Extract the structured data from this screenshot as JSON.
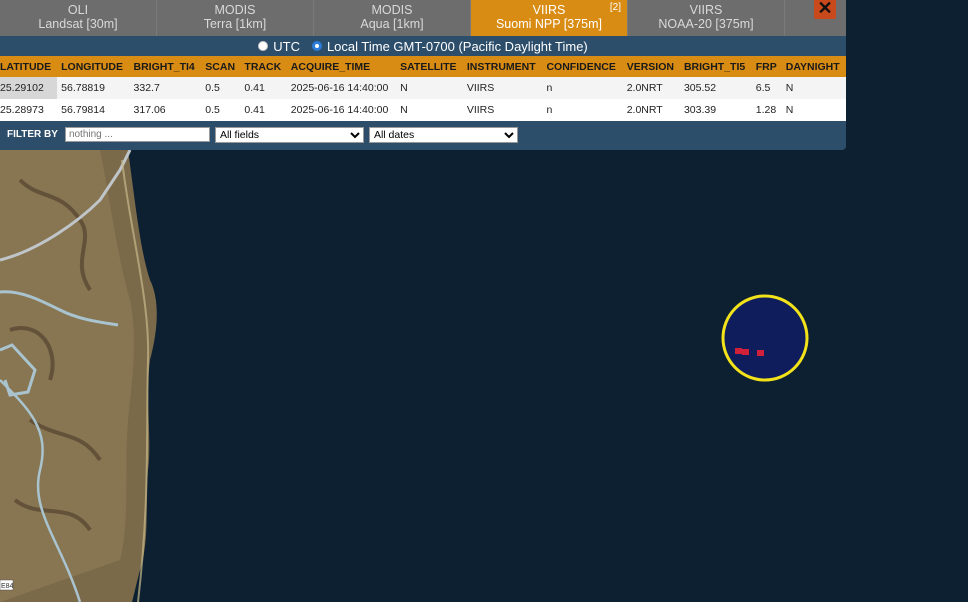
{
  "tabs": [
    {
      "line1": "OLI",
      "line2": "Landsat [30m]",
      "active": false,
      "count": ""
    },
    {
      "line1": "MODIS",
      "line2": "Terra [1km]",
      "active": false,
      "count": ""
    },
    {
      "line1": "MODIS",
      "line2": "Aqua [1km]",
      "active": false,
      "count": ""
    },
    {
      "line1": "VIIRS",
      "line2": "Suomi NPP [375m]",
      "active": true,
      "count": "[2]"
    },
    {
      "line1": "VIIRS",
      "line2": "NOAA-20 [375m]",
      "active": false,
      "count": ""
    }
  ],
  "close_label": "✕",
  "time_options": {
    "utc": "UTC",
    "local": "Local Time GMT-0700 (Pacific Daylight Time)",
    "selected": "local"
  },
  "table": {
    "columns": [
      "LATITUDE",
      "LONGITUDE",
      "BRIGHT_TI4",
      "SCAN",
      "TRACK",
      "ACQUIRE_TIME",
      "SATELLITE",
      "INSTRUMENT",
      "CONFIDENCE",
      "VERSION",
      "BRIGHT_TI5",
      "FRP",
      "DAYNIGHT"
    ],
    "rows": [
      [
        "25.29102",
        "56.78819",
        "332.7",
        "0.5",
        "0.41",
        "2025-06-16 14:40:00",
        "N",
        "VIIRS",
        "n",
        "2.0NRT",
        "305.52",
        "6.5",
        "N"
      ],
      [
        "25.28973",
        "56.79814",
        "317.06",
        "0.5",
        "0.41",
        "2025-06-16 14:40:00",
        "N",
        "VIIRS",
        "n",
        "2.0NRT",
        "303.39",
        "1.28",
        "N"
      ]
    ]
  },
  "filter": {
    "label": "FILTER BY",
    "placeholder": "nothing ...",
    "fields_value": "All fields",
    "dates_value": "All dates"
  },
  "map": {
    "road_label": "E84",
    "highlight_color": "#f2e21a",
    "hotspot_color": "#d0203a"
  }
}
